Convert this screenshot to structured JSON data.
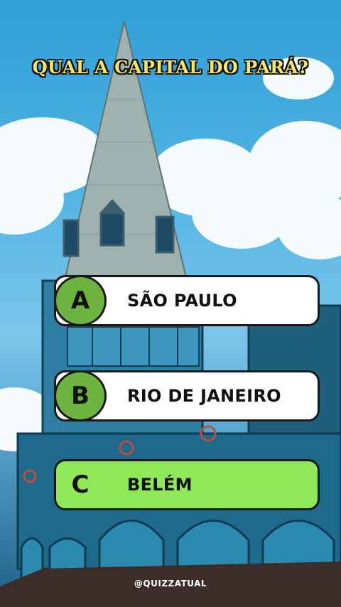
{
  "question": "QUAL A CAPITAL DO PARÁ?",
  "options": [
    {
      "letter": "A",
      "text": "SÃO PAULO"
    },
    {
      "letter": "B",
      "text": "RIO DE JANEIRO"
    },
    {
      "letter": "C",
      "text": "BELÉM"
    }
  ],
  "correct_option": "C",
  "handle": "@QUIZZATUAL",
  "colors": {
    "title_fill": "#f6e76a",
    "badge_green": "#6db33f",
    "correct_green": "#8ee857",
    "sky_blue": "#2f9fd6"
  }
}
